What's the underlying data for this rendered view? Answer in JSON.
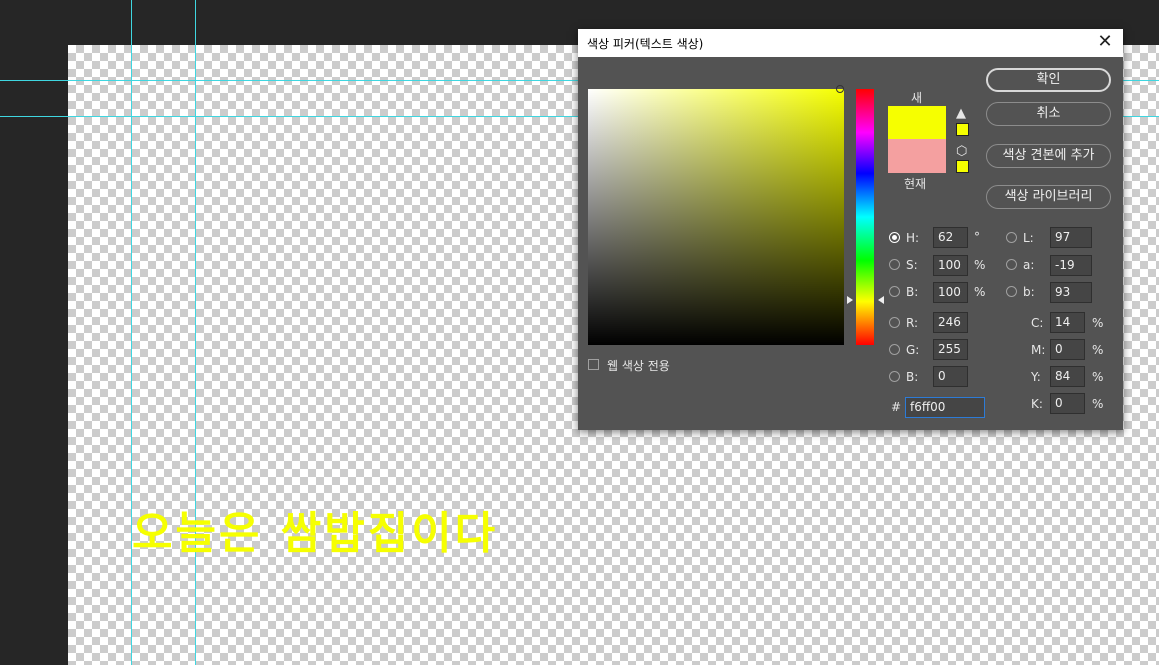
{
  "canvas": {
    "text": "오늘은 쌈밥집이다",
    "text_color": "#f6ff00"
  },
  "dialog": {
    "title": "색상 피커(텍스트 색상)",
    "close_glyph": "✕",
    "new_label": "새",
    "current_label": "현재",
    "new_color": "#f6ff00",
    "current_color": "#f4a0a0",
    "web_only_label": "웹 색상 전용",
    "buttons": {
      "ok": "확인",
      "cancel": "취소",
      "add_swatch": "색상 견본에 추가",
      "color_library": "색상 라이브러리"
    },
    "hsb": [
      {
        "label": "H:",
        "value": "62",
        "unit": "°",
        "selected": true
      },
      {
        "label": "S:",
        "value": "100",
        "unit": "%",
        "selected": false
      },
      {
        "label": "B:",
        "value": "100",
        "unit": "%",
        "selected": false
      }
    ],
    "rgb": [
      {
        "label": "R:",
        "value": "246"
      },
      {
        "label": "G:",
        "value": "255"
      },
      {
        "label": "B:",
        "value": "0"
      }
    ],
    "lab": [
      {
        "label": "L:",
        "value": "97"
      },
      {
        "label": "a:",
        "value": "-19"
      },
      {
        "label": "b:",
        "value": "93"
      }
    ],
    "cmyk": [
      {
        "label": "C:",
        "value": "14",
        "unit": "%"
      },
      {
        "label": "M:",
        "value": "0",
        "unit": "%"
      },
      {
        "label": "Y:",
        "value": "84",
        "unit": "%"
      },
      {
        "label": "K:",
        "value": "0",
        "unit": "%"
      }
    ],
    "hex_label": "#",
    "hex_value": "f6ff00"
  }
}
